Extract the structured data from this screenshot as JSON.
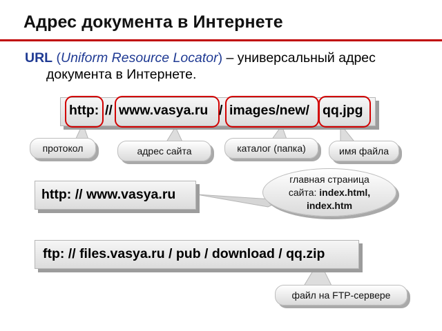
{
  "title": "Адрес документа в Интернете",
  "definition": {
    "term": "URL",
    "open_paren": "(",
    "expansion": "Uniform Resource Locator",
    "close_paren": ")",
    "rest_line1": " – универсальный адрес",
    "line2": "документа в Интернете."
  },
  "url_example": {
    "protocol": "http:",
    "sep1": "//",
    "site": "www.vasya.ru",
    "sep2": "/",
    "folder": "images/new/",
    "file": "qq.jpg"
  },
  "callouts": {
    "protocol": "протокол",
    "site": "адрес сайта",
    "folder": "каталог (папка)",
    "file": "имя файла"
  },
  "main_page_url": "http: // www.vasya.ru",
  "main_page_note": {
    "line1": "главная страница",
    "line2_prefix": "сайта: ",
    "line2_bold": "index.html,",
    "line3_bold": "index.htm"
  },
  "ftp_url": "ftp: // files.vasya.ru / pub / download / qq.zip",
  "ftp_note": "файл на FTP-сервере",
  "colors": {
    "title_rule": "#c00000",
    "frame": "#d20000",
    "term": "#1f3a93"
  }
}
